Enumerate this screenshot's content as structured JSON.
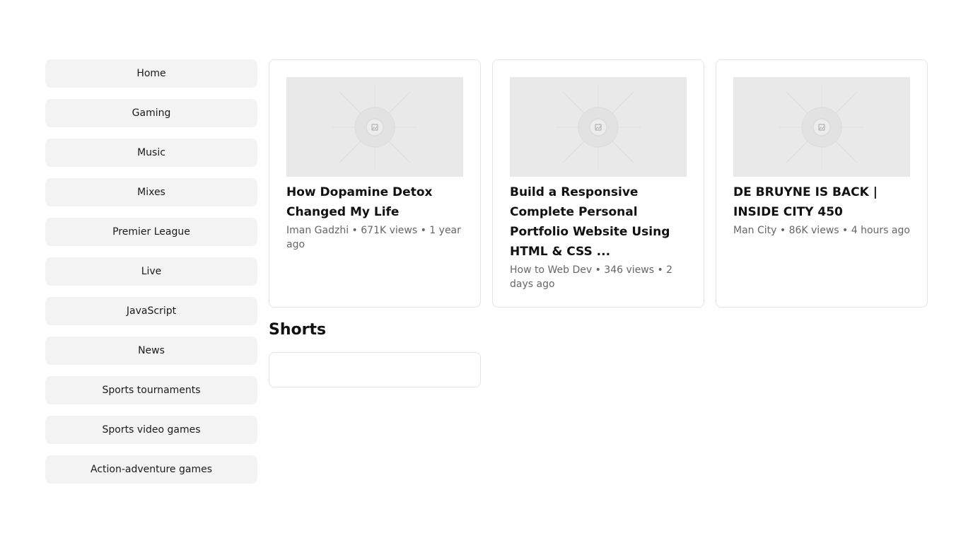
{
  "sidebar": {
    "items": [
      {
        "label": "Home"
      },
      {
        "label": "Gaming"
      },
      {
        "label": "Music"
      },
      {
        "label": "Mixes"
      },
      {
        "label": "Premier League"
      },
      {
        "label": "Live"
      },
      {
        "label": "JavaScript"
      },
      {
        "label": "News"
      },
      {
        "label": "Sports tournaments"
      },
      {
        "label": "Sports video games"
      },
      {
        "label": "Action-adventure games"
      }
    ]
  },
  "videos": [
    {
      "title": "How Dopamine Detox Changed My Life",
      "meta": "Iman Gadzhi • 671K views • 1 year ago",
      "thumbnail_icon": "image-placeholder-icon"
    },
    {
      "title": "Build a Responsive Complete Personal Portfolio Website Using HTML & CSS ...",
      "meta": "How to Web Dev • 346 views • 2 days ago",
      "thumbnail_icon": "image-placeholder-icon"
    },
    {
      "title": "DE BRUYNE IS BACK | INSIDE CITY 450",
      "meta": "Man City • 86K views • 4 hours ago",
      "thumbnail_icon": "image-placeholder-icon"
    }
  ],
  "shorts": {
    "heading": "Shorts"
  },
  "colors": {
    "sidebar_bg": "#f3f3f3",
    "thumbnail_bg": "#e9e9e9",
    "border": "#e4e4e4",
    "meta_text": "#666666"
  }
}
